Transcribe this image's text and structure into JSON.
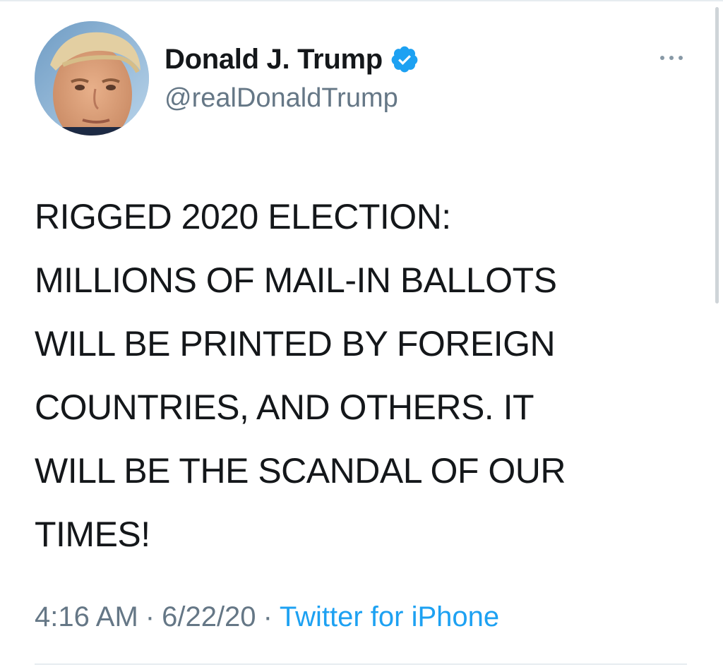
{
  "tweet": {
    "author": {
      "display_name": "Donald J. Trump",
      "handle": "@realDonaldTrump",
      "verified": true,
      "verified_icon": "verified-badge-icon",
      "avatar": "profile-photo"
    },
    "more_icon": "more-horizontal-icon",
    "text_lines": [
      "RIGGED 2020 ELECTION:",
      "MILLIONS OF MAIL-IN BALLOTS",
      "WILL BE PRINTED BY FOREIGN",
      "COUNTRIES, AND OTHERS. IT",
      "WILL BE THE SCANDAL OF OUR",
      "TIMES!"
    ],
    "meta": {
      "time": "4:16 AM",
      "separator": "·",
      "date": "6/22/20",
      "source": "Twitter for iPhone"
    }
  },
  "colors": {
    "text_primary": "#14171a",
    "text_secondary": "#657786",
    "accent": "#1da1f2",
    "divider": "#e6ecf0"
  }
}
